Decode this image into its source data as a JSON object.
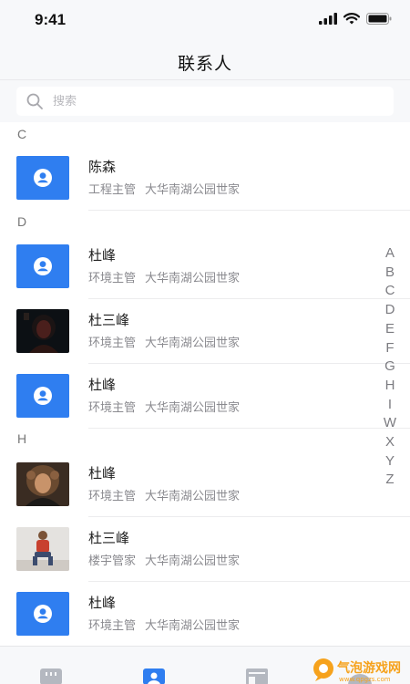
{
  "status_bar": {
    "time": "9:41"
  },
  "header": {
    "title": "联系人"
  },
  "search": {
    "placeholder": "搜索"
  },
  "sections": [
    {
      "letter": "C"
    },
    {
      "letter": "D"
    },
    {
      "letter": "H"
    }
  ],
  "contacts": [
    {
      "name": "陈森",
      "role": "工程主管",
      "location": "大华南湖公园世家",
      "avatar": "default-person-icon"
    },
    {
      "name": "杜峰",
      "role": "环境主管",
      "location": "大华南湖公园世家",
      "avatar": "default-person-icon"
    },
    {
      "name": "杜三峰",
      "role": "环境主管",
      "location": "大华南湖公园世家",
      "avatar": "photo-dark-portrait"
    },
    {
      "name": "杜峰",
      "role": "环境主管",
      "location": "大华南湖公园世家",
      "avatar": "default-person-icon"
    },
    {
      "name": "杜峰",
      "role": "环境主管",
      "location": "大华南湖公园世家",
      "avatar": "photo-curly-hair-portrait"
    },
    {
      "name": "杜三峰",
      "role": "楼宇管家",
      "location": "大华南湖公园世家",
      "avatar": "photo-seated-person"
    },
    {
      "name": "杜峰",
      "role": "环境主管",
      "location": "大华南湖公园世家",
      "avatar": "default-person-icon"
    }
  ],
  "index_letters": [
    "A",
    "B",
    "C",
    "D",
    "E",
    "F",
    "G",
    "H",
    "I",
    "W",
    "X",
    "Y",
    "Z"
  ],
  "tab_bar": {
    "tabs": [
      {
        "icon": "messages-icon",
        "active": false
      },
      {
        "icon": "contacts-icon",
        "active": true
      },
      {
        "icon": "apps-icon",
        "active": false
      },
      {
        "icon": "profile-icon",
        "active": false
      }
    ]
  },
  "watermark": {
    "text": "气泡游戏网",
    "subtext": "www.qpgzs.com"
  },
  "colors": {
    "accent": "#2f7ef0",
    "background": "#f7f8fa",
    "muted_text": "#8a8a8f"
  }
}
